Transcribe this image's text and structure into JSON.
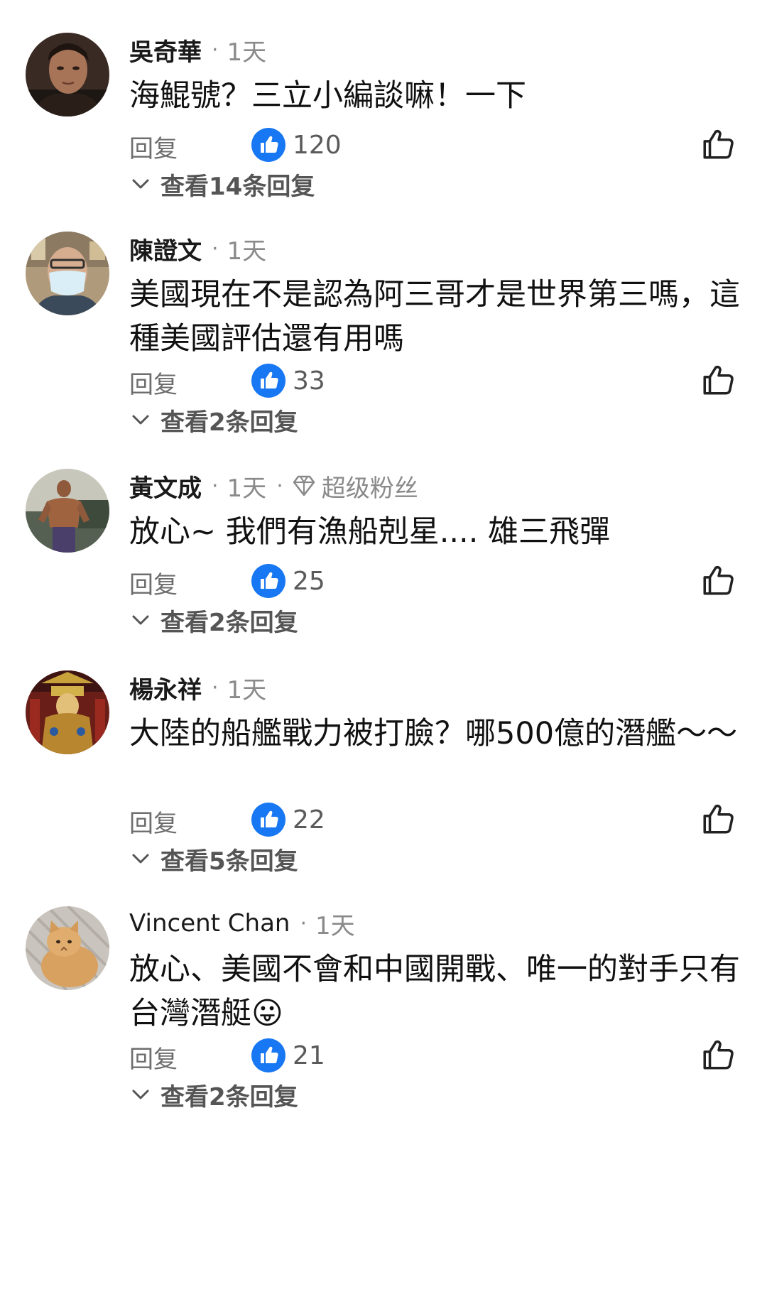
{
  "comments": [
    {
      "username": "吳奇華",
      "time": "1天",
      "text": "海鯤號？三立小編談嘛！一下",
      "reply_label": "回复",
      "reaction_count": "120",
      "view_replies": "查看14条回复",
      "avatar_icon": "man-portrait-avatar"
    },
    {
      "username": "陳證文",
      "time": "1天",
      "text": "美國現在不是認為阿三哥才是世界第三嗎，這種美國評估還有用嗎",
      "reply_label": "回复",
      "reaction_count": "33",
      "view_replies": "查看2条回复",
      "avatar_icon": "masked-man-avatar"
    },
    {
      "username": "黃文成",
      "time": "1天",
      "badge": "超级粉丝",
      "text": "放心~ 我們有漁船剋星.... 雄三飛彈",
      "reply_label": "回复",
      "reaction_count": "25",
      "view_replies": "查看2条回复",
      "avatar_icon": "bodybuilder-avatar"
    },
    {
      "username": "楊永祥",
      "time": "1天",
      "text": "大陸的船艦戰力被打臉？哪500億的潛艦～～",
      "reply_label": "回复",
      "reaction_count": "22",
      "view_replies": "查看5条回复",
      "avatar_icon": "temple-deity-avatar"
    },
    {
      "username": "Vincent Chan",
      "time": "1天",
      "text": "放心、美國不會和中國開戰、唯一的對手只有台灣潛艇😛",
      "reply_label": "回复",
      "reaction_count": "21",
      "view_replies": "查看2条回复",
      "avatar_icon": "cat-avatar"
    }
  ],
  "colors": {
    "like_blue": "#1877f2",
    "secondary_text": "#8a8a8a"
  }
}
